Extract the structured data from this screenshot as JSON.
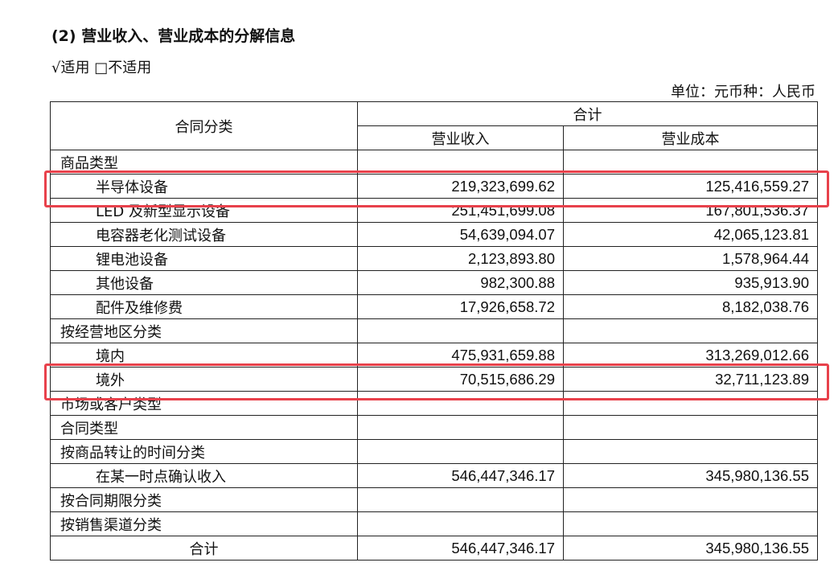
{
  "heading": "(2) 营业收入、营业成本的分解信息",
  "applicability": "√适用 □不适用",
  "unit": "单位：元币种：人民币",
  "table": {
    "header_contract": "合同分类",
    "header_total": "合计",
    "header_revenue": "营业收入",
    "header_cost": "营业成本",
    "rows": [
      {
        "label": "商品类型",
        "revenue": "",
        "cost": "",
        "kind": "cat"
      },
      {
        "label": "半导体设备",
        "revenue": "219,323,699.62",
        "cost": "125,416,559.27",
        "kind": "sub"
      },
      {
        "label": "LED 及新型显示设备",
        "revenue": "251,451,699.08",
        "cost": "167,801,536.37",
        "kind": "sub"
      },
      {
        "label": "电容器老化测试设备",
        "revenue": "54,639,094.07",
        "cost": "42,065,123.81",
        "kind": "sub"
      },
      {
        "label": "锂电池设备",
        "revenue": "2,123,893.80",
        "cost": "1,578,964.44",
        "kind": "sub"
      },
      {
        "label": "其他设备",
        "revenue": "982,300.88",
        "cost": "935,913.90",
        "kind": "sub"
      },
      {
        "label": "配件及维修费",
        "revenue": "17,926,658.72",
        "cost": "8,182,038.76",
        "kind": "sub"
      },
      {
        "label": "按经营地区分类",
        "revenue": "",
        "cost": "",
        "kind": "cat"
      },
      {
        "label": "境内",
        "revenue": "475,931,659.88",
        "cost": "313,269,012.66",
        "kind": "sub"
      },
      {
        "label": "境外",
        "revenue": "70,515,686.29",
        "cost": "32,711,123.89",
        "kind": "sub"
      },
      {
        "label": "市场或客户类型",
        "revenue": "",
        "cost": "",
        "kind": "cat"
      },
      {
        "label": "合同类型",
        "revenue": "",
        "cost": "",
        "kind": "cat"
      },
      {
        "label": "按商品转让的时间分类",
        "revenue": "",
        "cost": "",
        "kind": "cat"
      },
      {
        "label": "在某一时点确认收入",
        "revenue": "546,447,346.17",
        "cost": "345,980,136.55",
        "kind": "sub"
      },
      {
        "label": "按合同期限分类",
        "revenue": "",
        "cost": "",
        "kind": "cat"
      },
      {
        "label": "按销售渠道分类",
        "revenue": "",
        "cost": "",
        "kind": "cat"
      },
      {
        "label": "合计",
        "revenue": "546,447,346.17",
        "cost": "345,980,136.55",
        "kind": "center"
      }
    ]
  },
  "highlight_color": "#e8414b",
  "highlighted_rows": [
    "半导体设备",
    "境外"
  ]
}
